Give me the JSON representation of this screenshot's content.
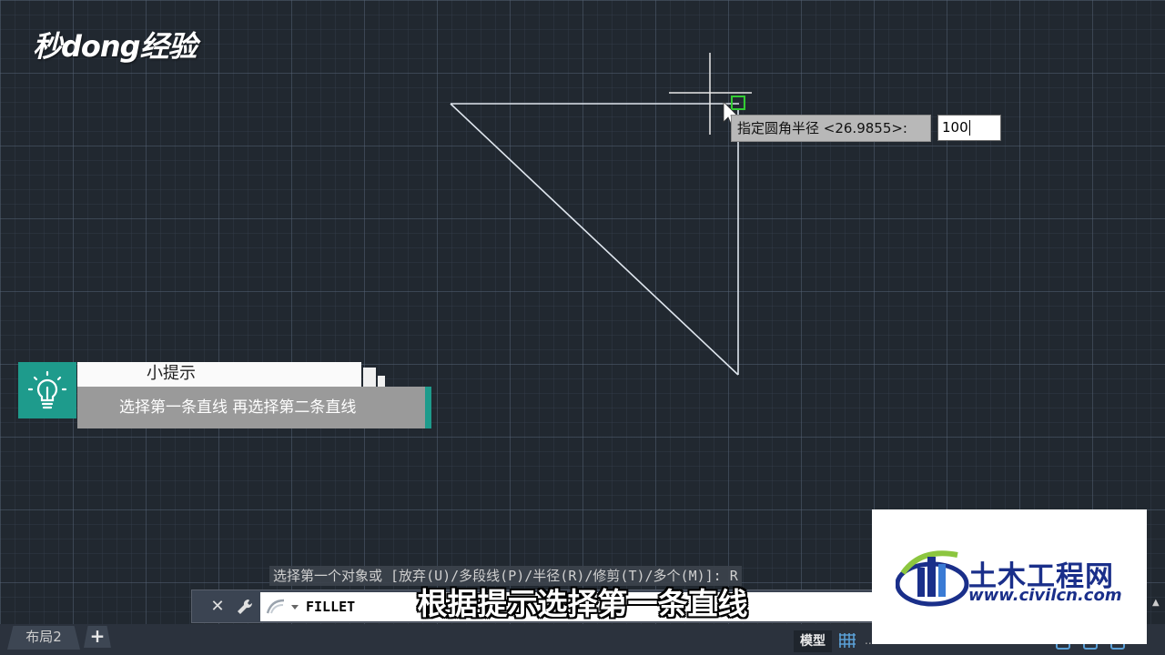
{
  "watermark": {
    "logo_text": "秒dong经验"
  },
  "drawing": {
    "line_color": "#dfe6ee",
    "snap_marker_color": "#33cc33",
    "cursor": "crosshair-pickbox"
  },
  "dynamic_input": {
    "prompt": "指定圆角半径 <26.9855>:",
    "value": "100"
  },
  "tip_card": {
    "title": "小提示",
    "body": "选择第一条直线  再选择第二条直线",
    "accent_color": "#1e9b8c",
    "icon": "lightbulb-icon"
  },
  "command_line": {
    "history": "选择第一个对象或 [放弃(U)/多段线(P)/半径(R)/修剪(T)/多个(M)]: R",
    "current_command": "FILLET",
    "close_icon": "close-icon",
    "customize_icon": "wrench-icon",
    "recent_icon": "recent-commands-icon"
  },
  "subtitle": "根据提示选择第一条直线",
  "status_bar": {
    "layout_tab": "布局2",
    "add_tab": "+",
    "model_button": "模型",
    "grid_icon": "grid-icon",
    "more_label": "..."
  },
  "civil_watermark": {
    "name_cn": "土木工程网",
    "url": "www.civilcn.com",
    "brand_color": "#1a2f8a"
  }
}
